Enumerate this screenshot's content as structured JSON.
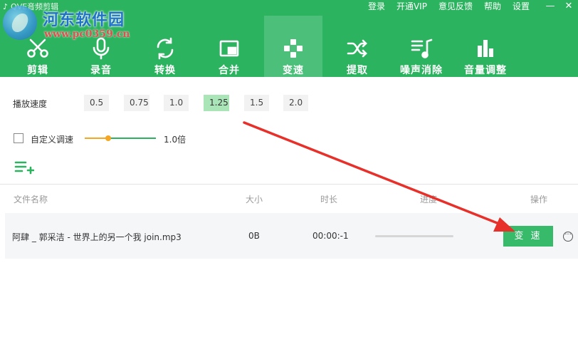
{
  "app": {
    "title": "QVE音频剪辑"
  },
  "watermark": {
    "name": "河东软件园",
    "url": "www.pc0359.cn"
  },
  "top_menu": [
    "登录",
    "开通VIP",
    "意见反馈",
    "帮助",
    "设置"
  ],
  "window_controls": [
    "—",
    "✕"
  ],
  "toolbar": [
    {
      "label": "剪辑",
      "icon": "scissors-icon"
    },
    {
      "label": "录音",
      "icon": "microphone-icon"
    },
    {
      "label": "转换",
      "icon": "convert-icon"
    },
    {
      "label": "合并",
      "icon": "merge-icon"
    },
    {
      "label": "变速",
      "icon": "gamepad-icon",
      "active": true
    },
    {
      "label": "提取",
      "icon": "shuffle-icon"
    },
    {
      "label": "噪声消除",
      "icon": "noise-music-icon"
    },
    {
      "label": "音量调整",
      "icon": "volume-bars-icon"
    }
  ],
  "speed": {
    "label": "播放速度",
    "options": [
      "0.5",
      "0.75",
      "1.0",
      "1.25",
      "1.5",
      "2.0"
    ],
    "selected": "1.25"
  },
  "custom_speed": {
    "label": "自定义调速",
    "checked": false,
    "slider_fraction": 0.33,
    "value_text": "1.0倍"
  },
  "table": {
    "headers": {
      "name": "文件名称",
      "size": "大小",
      "duration": "时长",
      "progress": "进度",
      "action": "操作"
    },
    "rows": [
      {
        "name": "阿肆 _ 郭采洁 - 世界上的另一个我 join.mp3",
        "size": "0B",
        "duration": "00:00:-1",
        "progress": 0,
        "action": "变 速",
        "more": "···"
      }
    ]
  },
  "colors": {
    "primary": "#2cb35f",
    "active_tab": "#4cc07a",
    "selected_speed": "#a9e5b7",
    "annotation": "#e8302a"
  }
}
